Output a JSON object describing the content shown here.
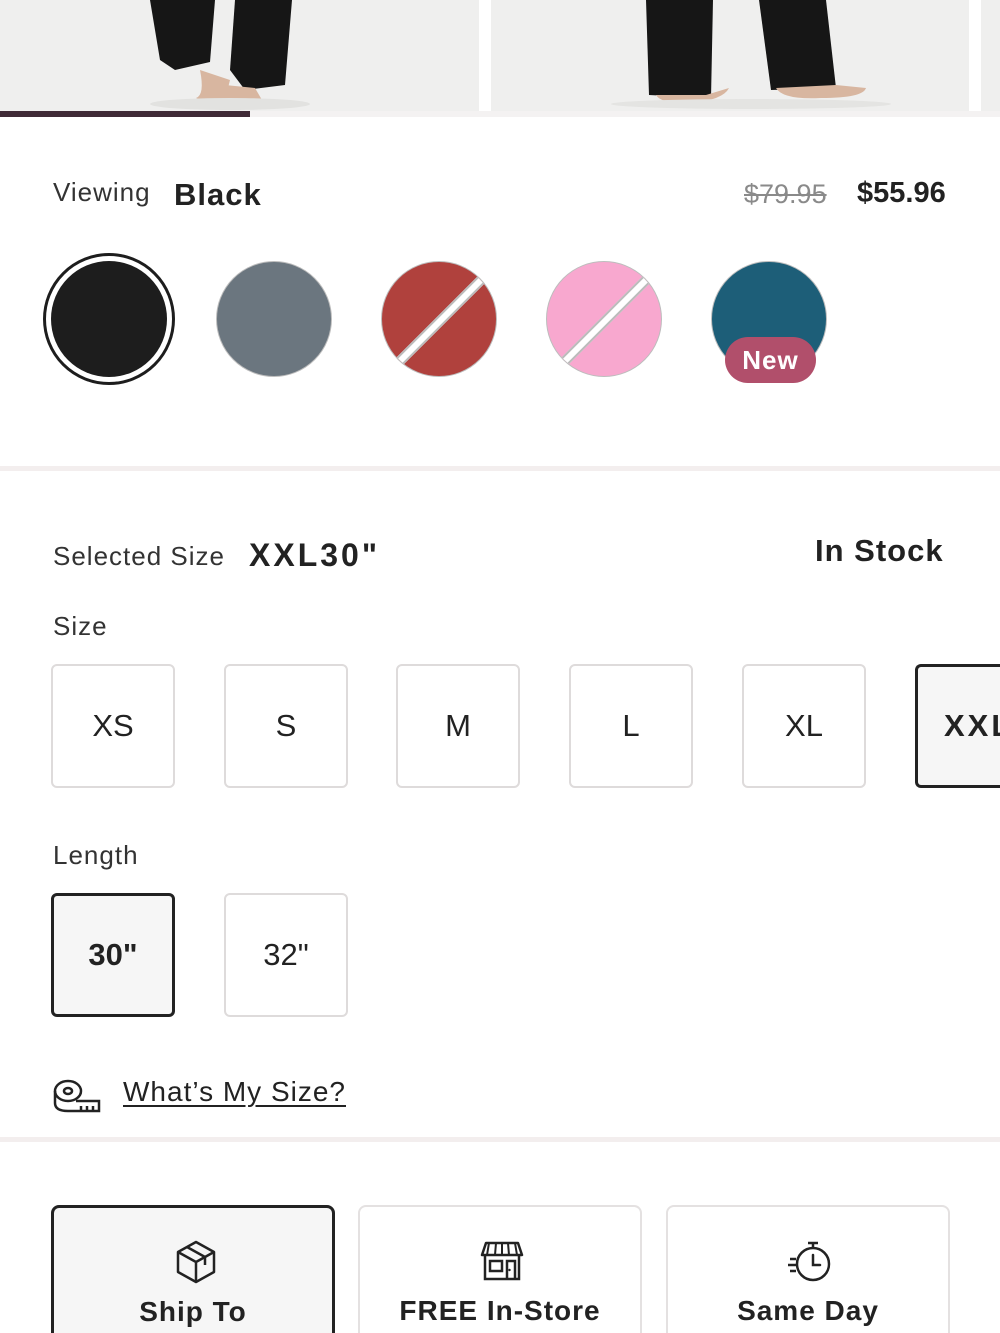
{
  "gallery": {
    "progress": 0.25
  },
  "color": {
    "label": "Viewing",
    "selected": "Black",
    "price_original": "$79.95",
    "price_sale": "$55.96",
    "swatches": [
      {
        "name": "black",
        "hex": "#1d1d1d",
        "selected": true
      },
      {
        "name": "grey",
        "hex": "#6b767f",
        "unavailable": false
      },
      {
        "name": "red",
        "hex": "#b0413d",
        "unavailable": true
      },
      {
        "name": "pink",
        "hex": "#f8a8cf",
        "unavailable": true
      },
      {
        "name": "teal",
        "hex": "#1d5e78",
        "badge": "New"
      }
    ],
    "badge_color": "#b14f6b"
  },
  "size": {
    "selected_label": "Selected Size",
    "selected_value": "XXL30\"",
    "stock": "In Stock",
    "size_label": "Size",
    "sizes": [
      "XS",
      "S",
      "M",
      "L",
      "XL",
      "XXL"
    ],
    "selected_size": "XXL",
    "length_label": "Length",
    "lengths": [
      "30\"",
      "32\""
    ],
    "selected_length": "30\""
  },
  "size_guide": {
    "link": "What’s My Size?",
    "icon": "measuring-tape-icon"
  },
  "fulfillment": {
    "options": [
      {
        "label": "Ship To",
        "icon": "box-icon",
        "selected": true
      },
      {
        "label": "FREE In-Store",
        "icon": "store-icon",
        "selected": false
      },
      {
        "label": "Same Day",
        "icon": "timer-icon",
        "selected": false
      }
    ]
  }
}
